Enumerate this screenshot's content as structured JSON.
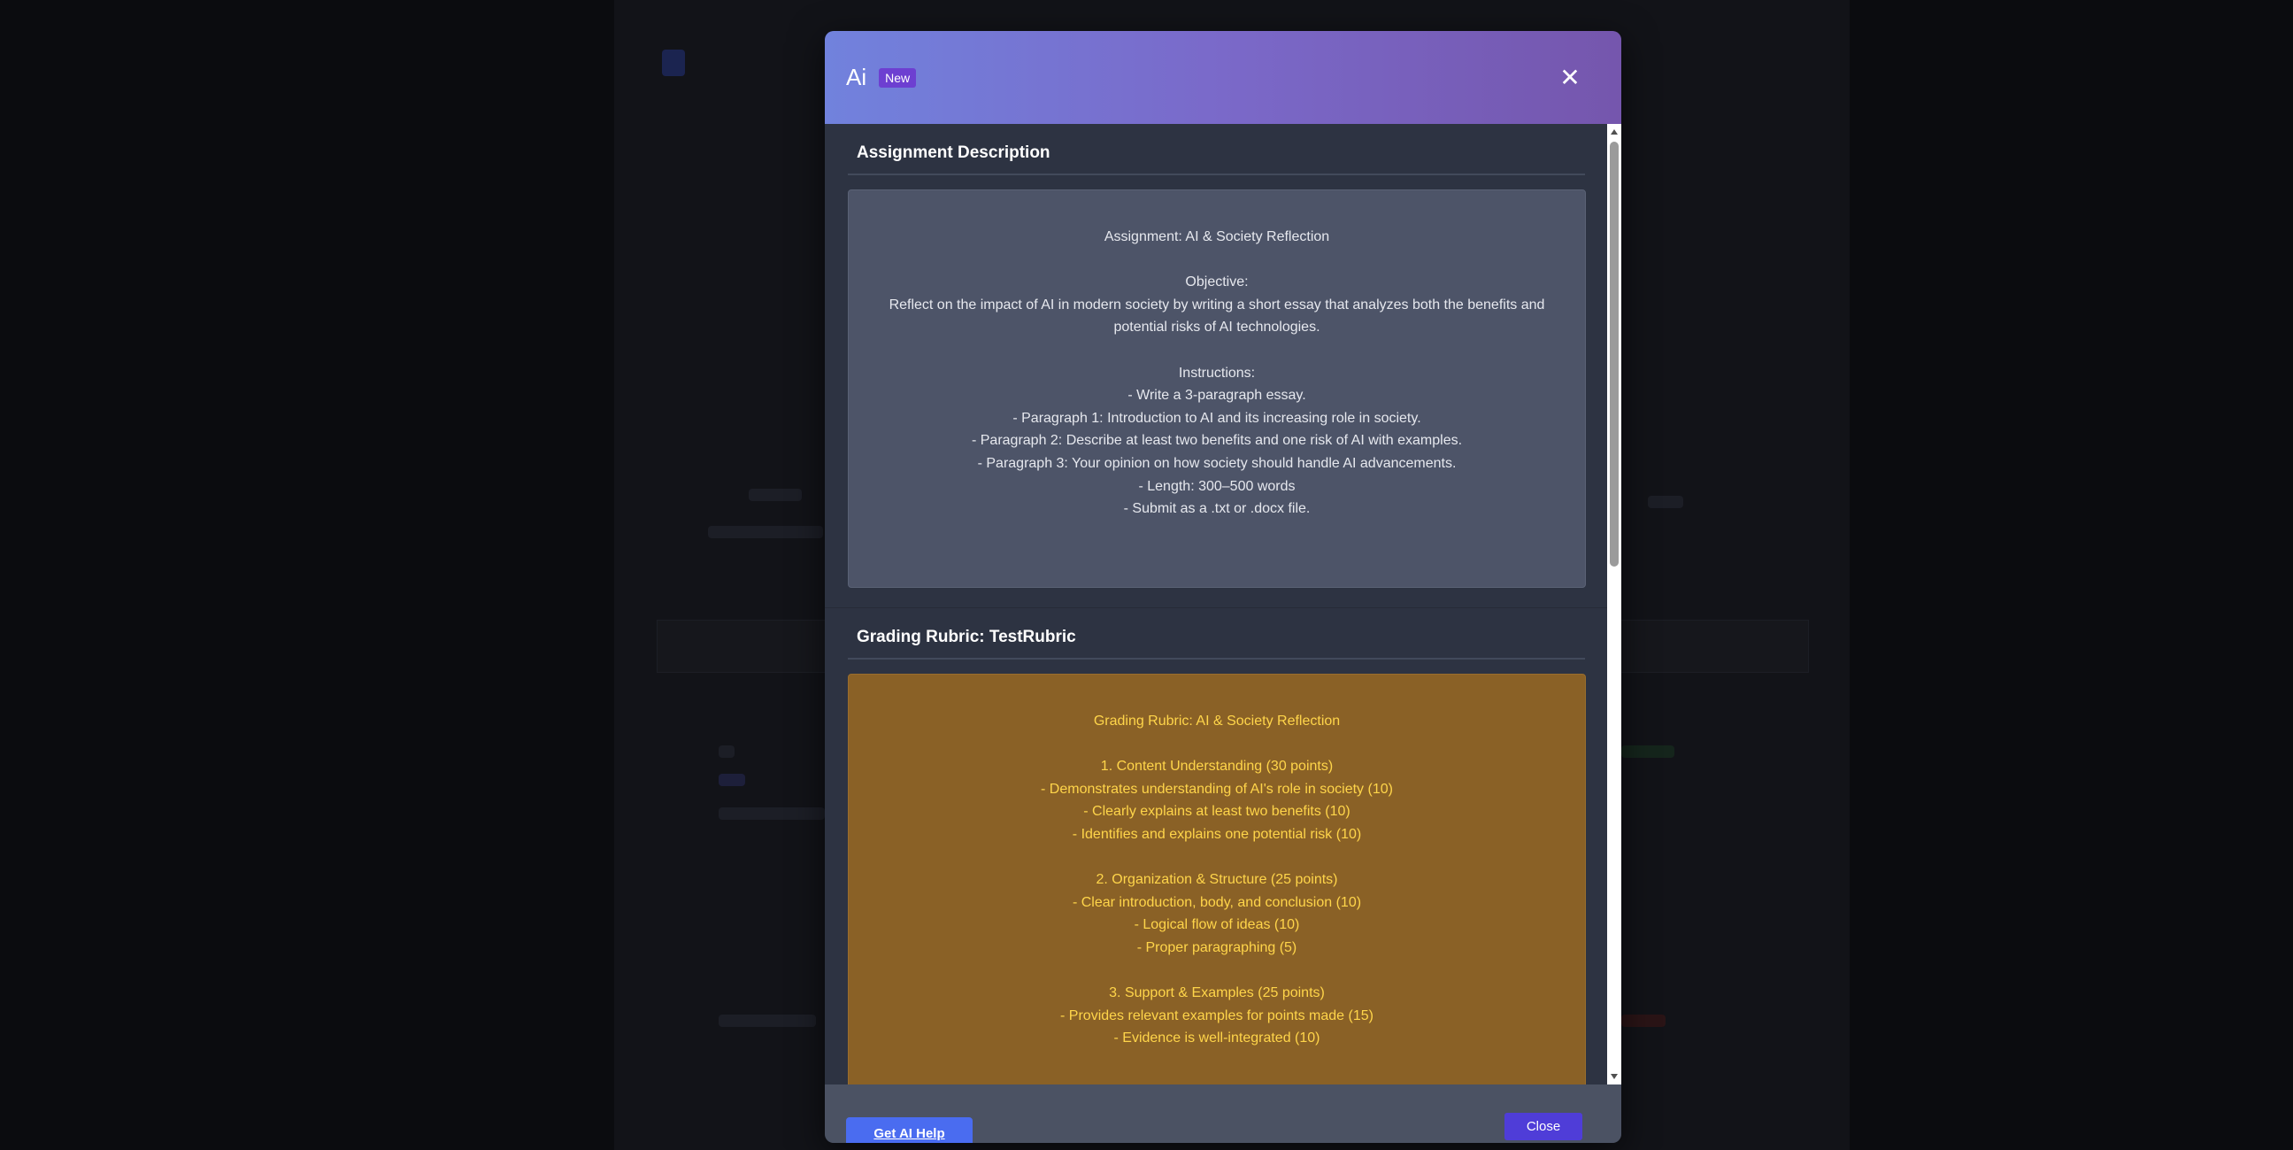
{
  "modal": {
    "title": "Ai",
    "badge": "New",
    "close_icon": "close-icon",
    "sections": {
      "description": {
        "title": "Assignment Description",
        "lines": [
          "Assignment: AI & Society Reflection",
          "",
          "Objective:",
          "Reflect on the impact of AI in modern society by writing a short essay that analyzes both the benefits and",
          "potential risks of AI technologies.",
          "",
          "Instructions:",
          "- Write a 3-paragraph essay.",
          "- Paragraph 1: Introduction to AI and its increasing role in society.",
          "- Paragraph 2: Describe at least two benefits and one risk of AI with examples.",
          "- Paragraph 3: Your opinion on how society should handle AI advancements.",
          "- Length: 300–500 words",
          "- Submit as a .txt or .docx file."
        ]
      },
      "rubric": {
        "title": "Grading Rubric: TestRubric",
        "lines": [
          "Grading Rubric: AI & Society Reflection",
          "",
          "1. Content Understanding (30 points)",
          "- Demonstrates understanding of AI's role in society (10)",
          "- Clearly explains at least two benefits (10)",
          "- Identifies and explains one potential risk (10)",
          "",
          "2. Organization & Structure (25 points)",
          "- Clear introduction, body, and conclusion (10)",
          "- Logical flow of ideas (10)",
          "- Proper paragraphing (5)",
          "",
          "3. Support & Examples (25 points)",
          "- Provides relevant examples for points made (15)",
          "- Evidence is well-integrated (10)"
        ]
      }
    },
    "footer": {
      "ai_help_label": "Get AI Help",
      "close_label": "Close"
    }
  },
  "colors": {
    "header_gradient_start": "#7182dd",
    "header_gradient_end": "#7556ad",
    "badge": "#6d3fd1",
    "ai_help_button": "#4a6cf0",
    "close_button": "#4f3dd8",
    "rubric_background": "#8a6126",
    "rubric_text": "#ffd54a"
  }
}
